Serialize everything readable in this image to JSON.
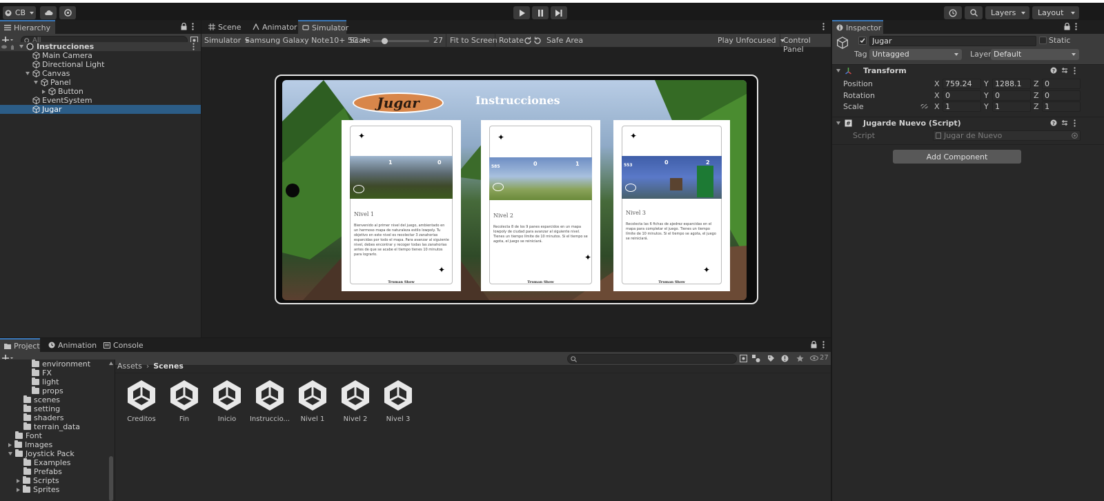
{
  "toolbar": {
    "account_label": "CB",
    "layers_label": "Layers",
    "layout_label": "Layout"
  },
  "hierarchy": {
    "tab_label": "Hierarchy",
    "search_placeholder": "All",
    "scene_name": "Instrucciones",
    "items": [
      {
        "label": "Main Camera"
      },
      {
        "label": "Directional Light"
      },
      {
        "label": "Canvas"
      },
      {
        "label": "Panel"
      },
      {
        "label": "Button"
      },
      {
        "label": "EventSystem"
      },
      {
        "label": "Jugar"
      }
    ]
  },
  "center": {
    "tabs": [
      {
        "label": "Scene"
      },
      {
        "label": "Animator"
      },
      {
        "label": "Simulator"
      }
    ],
    "mode_label": "Simulator",
    "device_label": "Samsung Galaxy Note10+ 5G",
    "scale_label": "Scale",
    "scale_value": "27",
    "scale_level": 0.18,
    "fit_label": "Fit to Screen",
    "rotate_label": "Rotate",
    "safe_area_label": "Safe Area",
    "play_unfocused_label": "Play Unfocused",
    "control_panel_label": "Control Panel"
  },
  "game": {
    "play_button_text": "Jugar",
    "title": "Instrucciones",
    "cards": [
      {
        "title": "Nivel 1",
        "hud_a": "1",
        "hud_b": "0",
        "text": "Bienvenido al primer nivel del juego, ambientado en un hermoso mapa de naturaleza estilo lowpoly. Tu objetivo en este nivel es recolectar 3 zanahorias esparcidas por todo el mapa. Para avanzar al siguiente nivel, debes encontrar y recoger todas las zanahorias antes de que se acabe el tiempo tienes 10 minutos para lograrlo.",
        "footer": "Truman Show"
      },
      {
        "title": "Nivel 2",
        "hud_a": "0",
        "hud_b": "1",
        "hud_time": "585",
        "text": "Recolecta 8 de los 9 panes esparcidos en un mapa lowpoly de ciudad para avanzar al siguiente nivel. Tienes un tiempo límite de 10 minutos. Si el tiempo se agota, el juego se reiniciará.",
        "footer": "Truman Show"
      },
      {
        "title": "Nivel 3",
        "hud_a": "0",
        "hud_b": "2",
        "hud_time": "553",
        "text": "Recolecta las 6 fichas de ajedrez esparcidas en el mapa para completar el juego. Tienes un tiempo límite de 10 minutos. Si el tiempo se agota, el juego se reiniciará.",
        "footer": "Truman Show"
      }
    ]
  },
  "inspector": {
    "tab_label": "Inspector",
    "object_name": "Jugar",
    "static_label": "Static",
    "tag_label": "Tag",
    "tag_value": "Untagged",
    "layer_label": "Layer",
    "layer_value": "Default",
    "transform_title": "Transform",
    "position_label": "Position",
    "rotation_label": "Rotation",
    "scale_label": "Scale",
    "axis_x": "X",
    "axis_y": "Y",
    "axis_z": "Z",
    "position": {
      "x": "759.24",
      "y": "1288.1",
      "z": "0"
    },
    "rotation": {
      "x": "0",
      "y": "0",
      "z": "0"
    },
    "scale": {
      "x": "1",
      "y": "1",
      "z": "1"
    },
    "script_component_title": "Jugarde Nuevo (Script)",
    "script_label": "Script",
    "script_value": "Jugar de Nuevo",
    "add_component_label": "Add Component"
  },
  "project": {
    "tabs": [
      {
        "label": "Project"
      },
      {
        "label": "Animation"
      },
      {
        "label": "Console"
      }
    ],
    "breadcrumb_root": "Assets",
    "breadcrumb_current": "Scenes",
    "visible_count": "27",
    "tree": [
      {
        "label": "environment"
      },
      {
        "label": "FX"
      },
      {
        "label": "light"
      },
      {
        "label": "props"
      },
      {
        "label": "scenes"
      },
      {
        "label": "setting"
      },
      {
        "label": "shaders"
      },
      {
        "label": "terrain_data"
      },
      {
        "label": "Font"
      },
      {
        "label": "Images"
      },
      {
        "label": "Joystick Pack"
      },
      {
        "label": "Examples"
      },
      {
        "label": "Prefabs"
      },
      {
        "label": "Scripts"
      },
      {
        "label": "Sprites"
      }
    ],
    "assets": [
      {
        "label": "Creditos"
      },
      {
        "label": "Fin"
      },
      {
        "label": "Inicio"
      },
      {
        "label": "Instruccio..."
      },
      {
        "label": "Nivel 1"
      },
      {
        "label": "Nivel 2"
      },
      {
        "label": "Nivel 3"
      }
    ]
  },
  "colors": {
    "selection": "#2c5d87",
    "panel": "#282828",
    "toolbar": "#191919",
    "accent": "#3a79bb"
  }
}
